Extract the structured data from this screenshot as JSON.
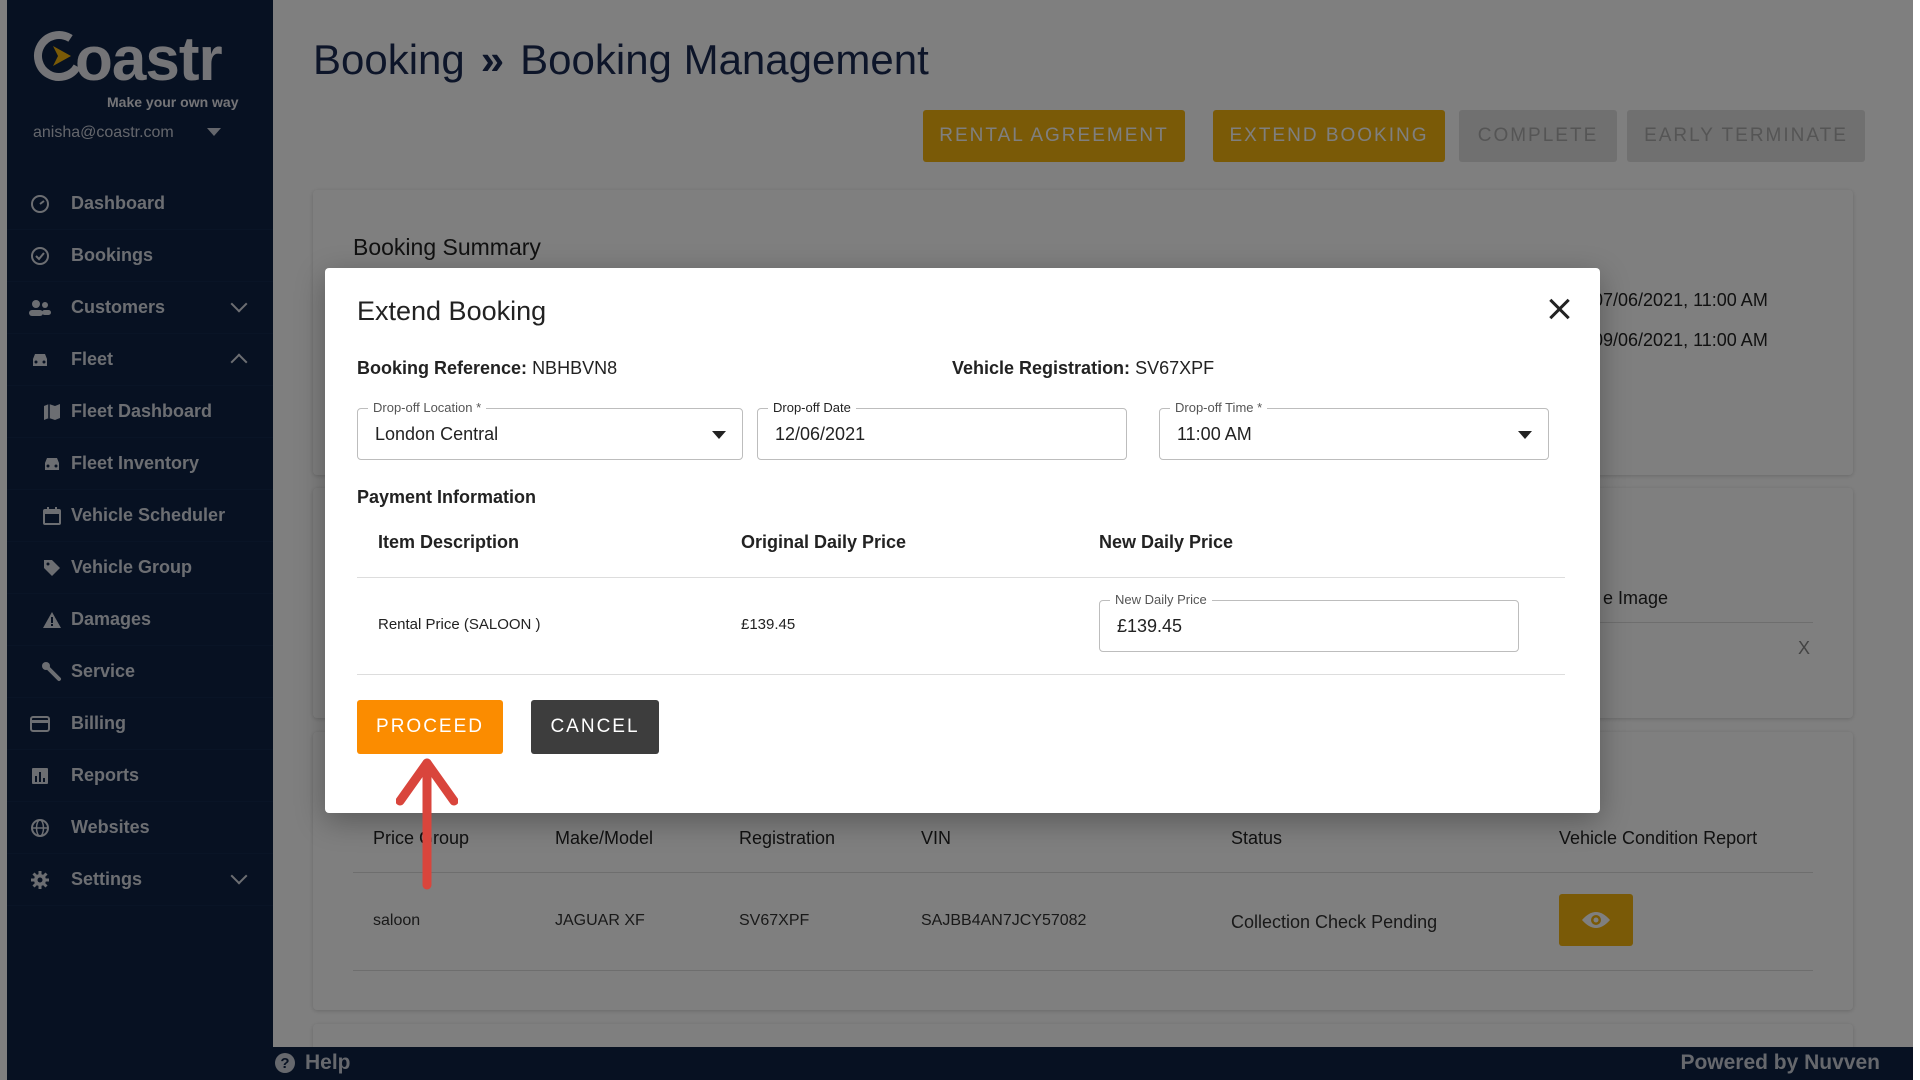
{
  "brand": {
    "name": "Coastr",
    "tagline": "Make your own way"
  },
  "user": {
    "email": "anisha@coastr.com"
  },
  "sidebar": {
    "items": [
      {
        "label": "Dashboard",
        "icon": "speedometer-icon"
      },
      {
        "label": "Bookings",
        "icon": "check-circle-icon"
      },
      {
        "label": "Customers",
        "icon": "people-icon",
        "expand": "down"
      },
      {
        "label": "Fleet",
        "icon": "car-icon",
        "expand": "up"
      },
      {
        "label": "Fleet Dashboard",
        "icon": "map-icon",
        "sub": true
      },
      {
        "label": "Fleet Inventory",
        "icon": "car-icon",
        "sub": true
      },
      {
        "label": "Vehicle Scheduler",
        "icon": "calendar-icon",
        "sub": true
      },
      {
        "label": "Vehicle Group",
        "icon": "tag-icon",
        "sub": true
      },
      {
        "label": "Damages",
        "icon": "warning-icon",
        "sub": true
      },
      {
        "label": "Service",
        "icon": "wrench-icon",
        "sub": true
      },
      {
        "label": "Billing",
        "icon": "credit-card-icon"
      },
      {
        "label": "Reports",
        "icon": "bar-chart-icon"
      },
      {
        "label": "Websites",
        "icon": "globe-icon"
      },
      {
        "label": "Settings",
        "icon": "gear-icon",
        "expand": "down"
      }
    ]
  },
  "header": {
    "crumb_parent": "Booking",
    "crumb_sep": "»",
    "crumb_current": "Booking Management",
    "actions": [
      "RENTAL AGREEMENT",
      "EXTEND BOOKING",
      "COMPLETE",
      "EARLY TERMINATE"
    ]
  },
  "background": {
    "summary_title": "Booking Summary",
    "date_line_1": ", 07/06/2021, 11:00 AM",
    "date_line_2": ", 09/06/2021, 11:00 AM",
    "image_header": "e Image",
    "image_close": "X",
    "vehicle_table": {
      "headers": [
        "Price Group",
        "Make/Model",
        "Registration",
        "VIN",
        "Status",
        "Vehicle Condition Report"
      ],
      "row": [
        "saloon",
        "JAGUAR XF",
        "SV67XPF",
        "SAJBB4AN7JCY57082",
        "Collection Check Pending"
      ]
    }
  },
  "modal": {
    "title": "Extend Booking",
    "booking_ref_label": "Booking Reference:",
    "booking_ref_value": "NBHBVN8",
    "vehicle_reg_label": "Vehicle Registration:",
    "vehicle_reg_value": "SV67XPF",
    "dropoff_location": {
      "label": "Drop-off Location *",
      "value": "London Central"
    },
    "dropoff_date": {
      "label": "Drop-off Date",
      "value": "12/06/2021"
    },
    "dropoff_time": {
      "label": "Drop-off Time *",
      "value": "11:00 AM"
    },
    "payment_heading": "Payment Information",
    "table_headers": [
      "Item Description",
      "Original Daily Price",
      "New Daily Price"
    ],
    "row": {
      "description": "Rental Price (SALOON )",
      "original": "£139.45"
    },
    "new_price": {
      "label": "New Daily Price",
      "value": "£139.45"
    },
    "proceed_label": "PROCEED",
    "cancel_label": "CANCEL"
  },
  "footer": {
    "help": "Help",
    "powered": "Powered by Nuvven"
  },
  "colors": {
    "sidebar": "#0e2244",
    "accent_yellow": "#f5b50e",
    "proceed_orange": "#fb8c00",
    "arrow_red": "#d9453c"
  }
}
